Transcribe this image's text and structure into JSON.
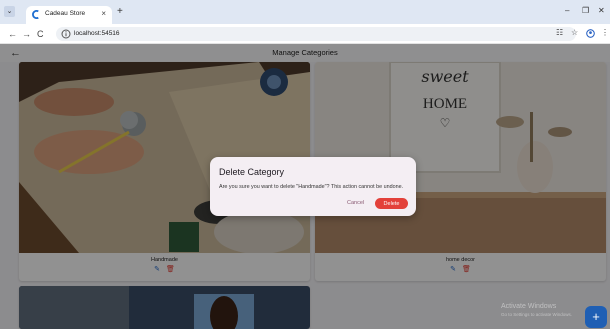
{
  "browser": {
    "tab_title": "Cadeau Store",
    "tab_close": "×",
    "new_tab": "+",
    "url": "localhost:54516",
    "controls": {
      "minimize": "–",
      "restore": "❐",
      "close": "✕"
    },
    "nav": {
      "back": "←",
      "forward": "→",
      "reload": "C"
    },
    "toolbar": {
      "extensions": "☷",
      "star": "☆",
      "menu": "⋮"
    }
  },
  "app": {
    "title": "Manage Categories",
    "back_icon": "←"
  },
  "categories": [
    {
      "name": "Handmade",
      "edit_icon": "✎",
      "delete_icon": "🗑"
    },
    {
      "name": "home decor",
      "edit_icon": "✎",
      "delete_icon": "🗑",
      "image_text_top": "sweet",
      "image_text_bottom": "HOME",
      "image_heart": "♡"
    }
  ],
  "dialog": {
    "title": "Delete Category",
    "message": "Are you sure you want to delete \"Handmade\"? This action cannot be undone.",
    "cancel_label": "Cancel",
    "delete_label": "Delete"
  },
  "windows_watermark": {
    "title": "Activate Windows",
    "subtitle": "Go to Settings to activate Windows."
  },
  "fab_label": "+",
  "colors": {
    "accent": "#1f5fb4",
    "danger": "#e3413a",
    "edit_icon": "#1e63c7",
    "delete_icon": "#e0362c"
  }
}
